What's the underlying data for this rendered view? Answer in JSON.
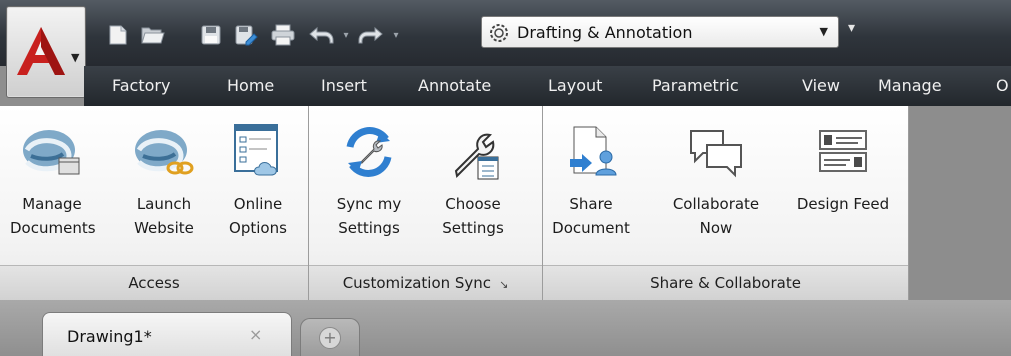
{
  "quick_access": {
    "icons": [
      "new-icon",
      "open-icon",
      "save-icon",
      "save-as-icon",
      "plot-icon",
      "undo-icon",
      "redo-icon"
    ],
    "workspace_value": "Drafting & Annotation"
  },
  "tabs": [
    {
      "label": "Factory"
    },
    {
      "label": "Home"
    },
    {
      "label": "Insert"
    },
    {
      "label": "Annotate"
    },
    {
      "label": "Layout"
    },
    {
      "label": "Parametric"
    },
    {
      "label": "View"
    },
    {
      "label": "Manage"
    },
    {
      "label": "O"
    }
  ],
  "panels": {
    "access": {
      "title": "Access",
      "buttons": [
        {
          "line1": "Manage",
          "line2": "Documents"
        },
        {
          "line1": "Launch",
          "line2": "Website"
        },
        {
          "line1": "Online",
          "line2": "Options"
        }
      ]
    },
    "customization": {
      "title": "Customization Sync",
      "launcher": "↘",
      "buttons": [
        {
          "line1": "Sync my",
          "line2": "Settings"
        },
        {
          "line1": "Choose",
          "line2": "Settings"
        }
      ]
    },
    "share": {
      "title": "Share & Collaborate",
      "buttons": [
        {
          "line1": "Share",
          "line2": "Document"
        },
        {
          "line1": "Collaborate",
          "line2": "Now"
        },
        {
          "line1": "Design Feed",
          "line2": ""
        }
      ]
    }
  },
  "doc_tabs": {
    "active": "Drawing1*",
    "close": "×",
    "new": "+"
  },
  "colors": {
    "accent": "#c8201e",
    "titlebar": "#2f353c",
    "ribbon_bg": "#f3f3f3"
  }
}
